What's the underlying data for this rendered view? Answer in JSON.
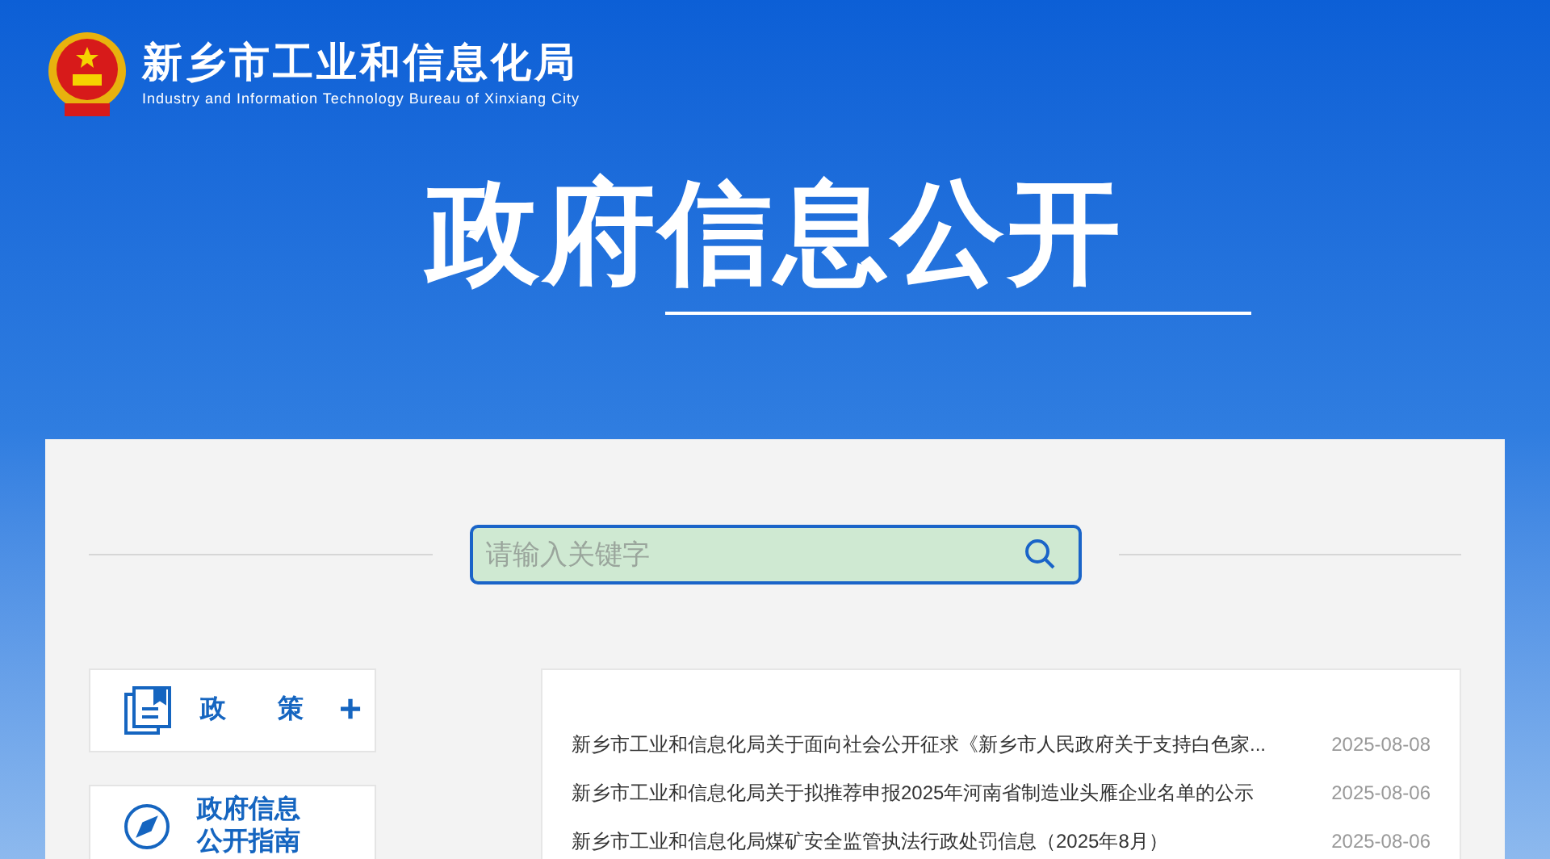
{
  "header": {
    "title": "新乡市工业和信息化局",
    "subtitle": "Industry and Information Technology Bureau of Xinxiang City"
  },
  "banner": {
    "title": "政府信息公开"
  },
  "search": {
    "placeholder": "请输入关键字"
  },
  "sidebar": {
    "items": [
      {
        "kind": "policy",
        "label": "政　　策",
        "toggle": "+"
      },
      {
        "kind": "guide",
        "label": "政府信息公开指南"
      }
    ]
  },
  "news": {
    "rows": [
      {
        "title": "新乡市工业和信息化局关于面向社会公开征求《新乡市人民政府关于支持白色家...",
        "date": "2025-08-08"
      },
      {
        "title": "新乡市工业和信息化局关于拟推荐申报2025年河南省制造业头雁企业名单的公示",
        "date": "2025-08-06"
      },
      {
        "title": "新乡市工业和信息化局煤矿安全监管执法行政处罚信息（2025年8月）",
        "date": "2025-08-06"
      }
    ]
  }
}
